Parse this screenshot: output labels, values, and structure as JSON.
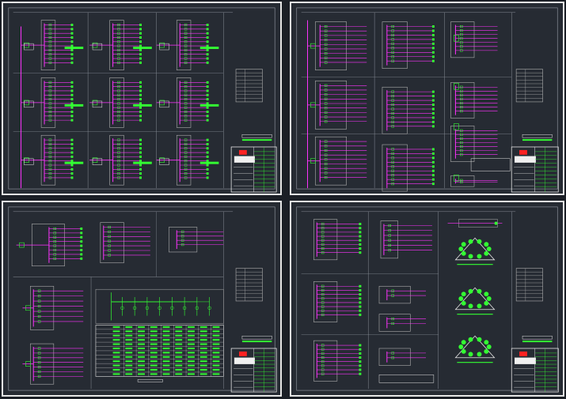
{
  "viewer": {
    "layout": "2x2 drawing sheets",
    "background_color": "#1b1f26",
    "sheet_background_color": "#262b33"
  },
  "colors": {
    "frame": "#e6e6e6",
    "grid_line": "#8a8f99",
    "wire": "#ff33ff",
    "device": "#33ff33",
    "box": "#b0b0b0",
    "title_block_red": "#ff2222",
    "label_green": "#33ff33"
  },
  "sheets": [
    {
      "id": "sheet-1",
      "kind": "distribution panels 3x3"
    },
    {
      "id": "sheet-2",
      "kind": "distribution panels with outgoing circuits"
    },
    {
      "id": "sheet-3",
      "kind": "panels and device table"
    },
    {
      "id": "sheet-4",
      "kind": "panels and lighting plan symbols"
    }
  ]
}
